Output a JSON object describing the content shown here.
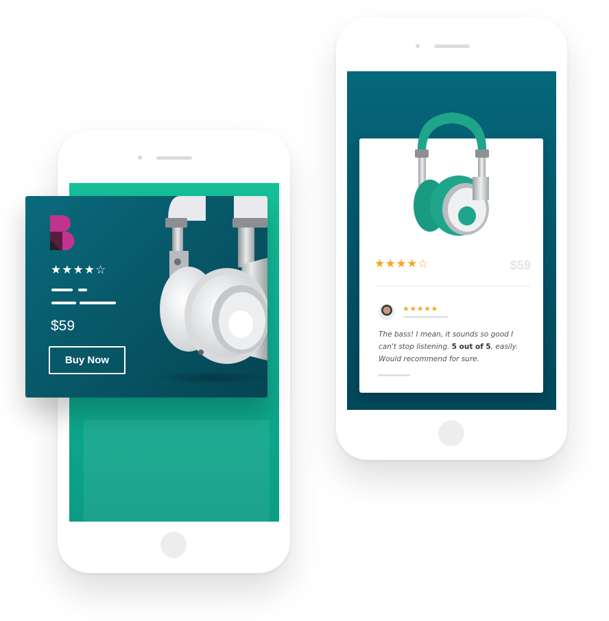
{
  "product_card": {
    "rating_stars": "★★★★☆",
    "rating_value": 4,
    "price": "$59",
    "buy_button_label": "Buy Now",
    "logo_icon": "brand-b-logo",
    "image_icon": "white-headphones-image"
  },
  "review_card": {
    "rating_stars": "★★★★☆",
    "rating_value": 4,
    "price": "$59",
    "image_icon": "teal-headphones-image",
    "review": {
      "avatar_icon": "reviewer-avatar",
      "stars": "★★★★★",
      "stars_value": 5,
      "text_before": "The bass! I mean, it sounds so good I can't stop listening. ",
      "text_bold": "5 out of 5",
      "text_after": ", easily. Would recommend for sure."
    }
  },
  "colors": {
    "teal_screen": "#16c19a",
    "dark_teal": "#075565",
    "star_orange": "#f5a623",
    "brand_pink": "#c2338e"
  }
}
